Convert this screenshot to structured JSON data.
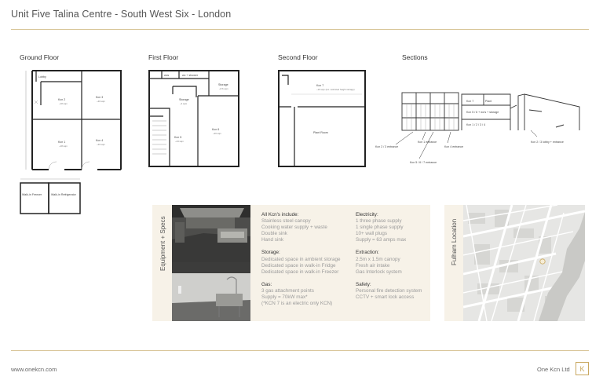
{
  "page": {
    "title": "Unit Five Talina Centre - South West Six - London"
  },
  "floors": {
    "ground": {
      "heading": "Ground Floor",
      "lobby": "Lobby",
      "kcn2": "Kcn 2",
      "kcn2_area": "~18 sqm",
      "kcn3": "Kcn 3",
      "kcn3_area": "~20 sqm",
      "kcn1": "Kcn 1",
      "kcn1_area": "~18 sqm",
      "kcn4": "Kcn 4",
      "kcn4_area": "~20 sqm",
      "freezer": "Walk-in Freezer",
      "fridge": "Walk-in Refrigerator"
    },
    "first": {
      "heading": "First Floor",
      "wc": "wcs",
      "shower": "wc + shower",
      "storage_right": "Storage",
      "storage_right_area": "~8.6 sqm",
      "storage_left": "Storage",
      "storage_left_area": "~4 sqm",
      "kcn5": "Kcn 5",
      "kcn5_area": "~23 sqm",
      "kcn6": "Kcn 6",
      "kcn6_area": "~26 sqm"
    },
    "second": {
      "heading": "Second Floor",
      "kcn7": "Kcn 7",
      "kcn7_area": "~16 sqm (inc. restricted height storage)",
      "plant": "Plant Room"
    },
    "sections": {
      "heading": "Sections",
      "l_kcn7": "Kcn 7",
      "l_plant": "Plant",
      "l_kcn56": "Kcn 5 / 6 + wc's + storage",
      "l_kcn1234": "Kcn 1 / 2 / 3 / 4",
      "l_k2": "Kcn 2 / 3 entrance",
      "l_k1": "Kcn 1 entrance",
      "l_k4": "Kcn 4 entrance",
      "l_k567": "Kcn 5 / 6 / 7 entrance",
      "l_k23": "Kcn 2 / 3 lobby + entrance"
    }
  },
  "specs": {
    "panel_label": "Equipment + Specs",
    "all_kcns": {
      "heading": "All Kcn's include:",
      "items": [
        "Stainless steel canopy",
        "Cooking water supply + waste",
        "Double sink",
        "Hand sink"
      ]
    },
    "storage": {
      "heading": "Storage:",
      "items": [
        "Dedicated space in ambient storage",
        "Dedicated space in walk-in Fridge",
        "Dedicated space in walk-in Freezer"
      ]
    },
    "gas": {
      "heading": "Gas:",
      "items": [
        "3 gas attachment points",
        "Supply = 70kW max*",
        "(*KCN 7 is an electric only KCN)"
      ]
    },
    "electricity": {
      "heading": "Electricity:",
      "items": [
        "1 three phase supply",
        "1 single phase supply",
        "10+ wall plugs",
        "Supply = 63 amps max"
      ]
    },
    "extraction": {
      "heading": "Extraction:",
      "items": [
        "2.5m x 1.5m canopy",
        "Fresh air intake",
        "Gas Interlock system"
      ]
    },
    "safety": {
      "heading": "Safety:",
      "items": [
        "Personal fire detection system",
        "CCTV + smart lock access"
      ]
    }
  },
  "location": {
    "panel_label": "Fulham Location"
  },
  "footer": {
    "url": "www.onekcn.com",
    "company": "One Kcn Ltd",
    "logo_glyph": "K"
  },
  "colors": {
    "accent": "#c9a860",
    "rule": "#d9c69a",
    "panel": "#f7f2e8"
  }
}
